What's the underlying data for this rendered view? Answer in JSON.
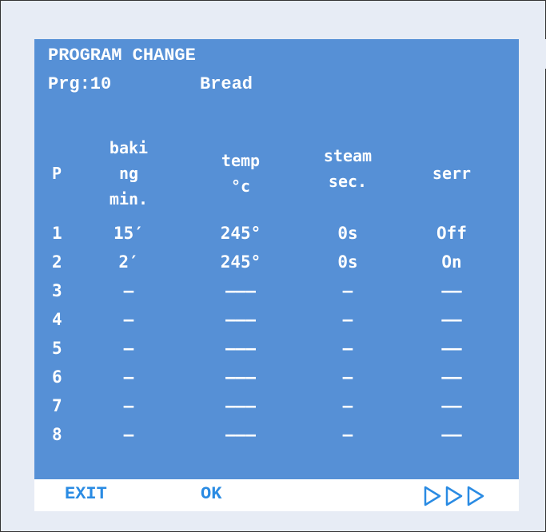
{
  "header": {
    "title": "PROGRAM CHANGE",
    "program_label": "Prg:10",
    "program_name": "Bread"
  },
  "columns": {
    "p": "P",
    "baking": [
      "baki",
      "ng",
      "min."
    ],
    "temp": [
      "temp",
      "°c"
    ],
    "steam": [
      "steam",
      "sec."
    ],
    "serr": "serr"
  },
  "rows": [
    {
      "p": "1",
      "baking": "15′",
      "temp": "245°",
      "steam": "0s",
      "serr": "Off"
    },
    {
      "p": "2",
      "baking": "2′",
      "temp": "245°",
      "steam": "0s",
      "serr": "On"
    },
    {
      "p": "3",
      "baking": "–",
      "temp": "–––",
      "steam": "–",
      "serr": "––"
    },
    {
      "p": "4",
      "baking": "–",
      "temp": "–––",
      "steam": "–",
      "serr": "––"
    },
    {
      "p": "5",
      "baking": "–",
      "temp": "–––",
      "steam": "–",
      "serr": "––"
    },
    {
      "p": "6",
      "baking": "–",
      "temp": "–––",
      "steam": "–",
      "serr": "––"
    },
    {
      "p": "7",
      "baking": "–",
      "temp": "–––",
      "steam": "–",
      "serr": "––"
    },
    {
      "p": "8",
      "baking": "–",
      "temp": "–––",
      "steam": "–",
      "serr": "––"
    }
  ],
  "footer": {
    "exit_label": "EXIT",
    "ok_label": "OK",
    "next_icon": "triple-play-arrow-icon"
  },
  "colors": {
    "screen": "#5690d6",
    "text": "#ffffff",
    "accent": "#2a8be3"
  }
}
